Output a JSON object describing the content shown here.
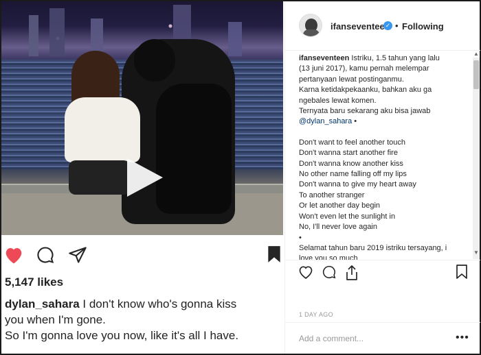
{
  "post_media": {
    "likes": "5,147 likes",
    "caption_user": "dylan_sahara",
    "caption_line1": " I don't know who's gonna kiss",
    "caption_line2": "you when I'm gone.",
    "caption_line3": "So I'm gonna love you now, like it's all I have."
  },
  "header": {
    "username": "ifanseventeen",
    "verified_glyph": "✓",
    "separator": "•",
    "follow_state": "Following"
  },
  "comment": {
    "username": "ifanseventeen",
    "lines": [
      " Istriku, 1.5 tahun yang lalu",
      "(13 juni 2017), kamu pernah melempar",
      "pertanyaan lewat postinganmu.",
      "Karna ketidakpekaanku, bahkan aku ga",
      "ngebales lewat komen.",
      "Ternyata baru sekarang aku bisa jawab"
    ],
    "mention": "@dylan_sahara",
    "mention_suffix": " •",
    "lyrics": [
      "Don't want to feel another touch",
      "Don't wanna start another fire",
      "Don't wanna know another kiss",
      "No other name falling off my lips",
      "Don't wanna to give my heart away",
      "To another stranger",
      "Or let another day begin",
      "Won't even let the sunlight in",
      "No, I'll never love again",
      "•",
      "Selamat tahun baru 2019 istriku tersayang, i",
      "love you so much"
    ]
  },
  "meta": {
    "time_ago": "1 DAY AGO"
  },
  "add_comment": {
    "placeholder": "Add a comment...",
    "more_glyph": "•••"
  },
  "icons": {
    "like": "heart-icon",
    "comment": "speech-bubble-icon",
    "share": "share-icon",
    "save": "bookmark-icon",
    "play": "play-icon",
    "accent_like": "#ed4956"
  }
}
